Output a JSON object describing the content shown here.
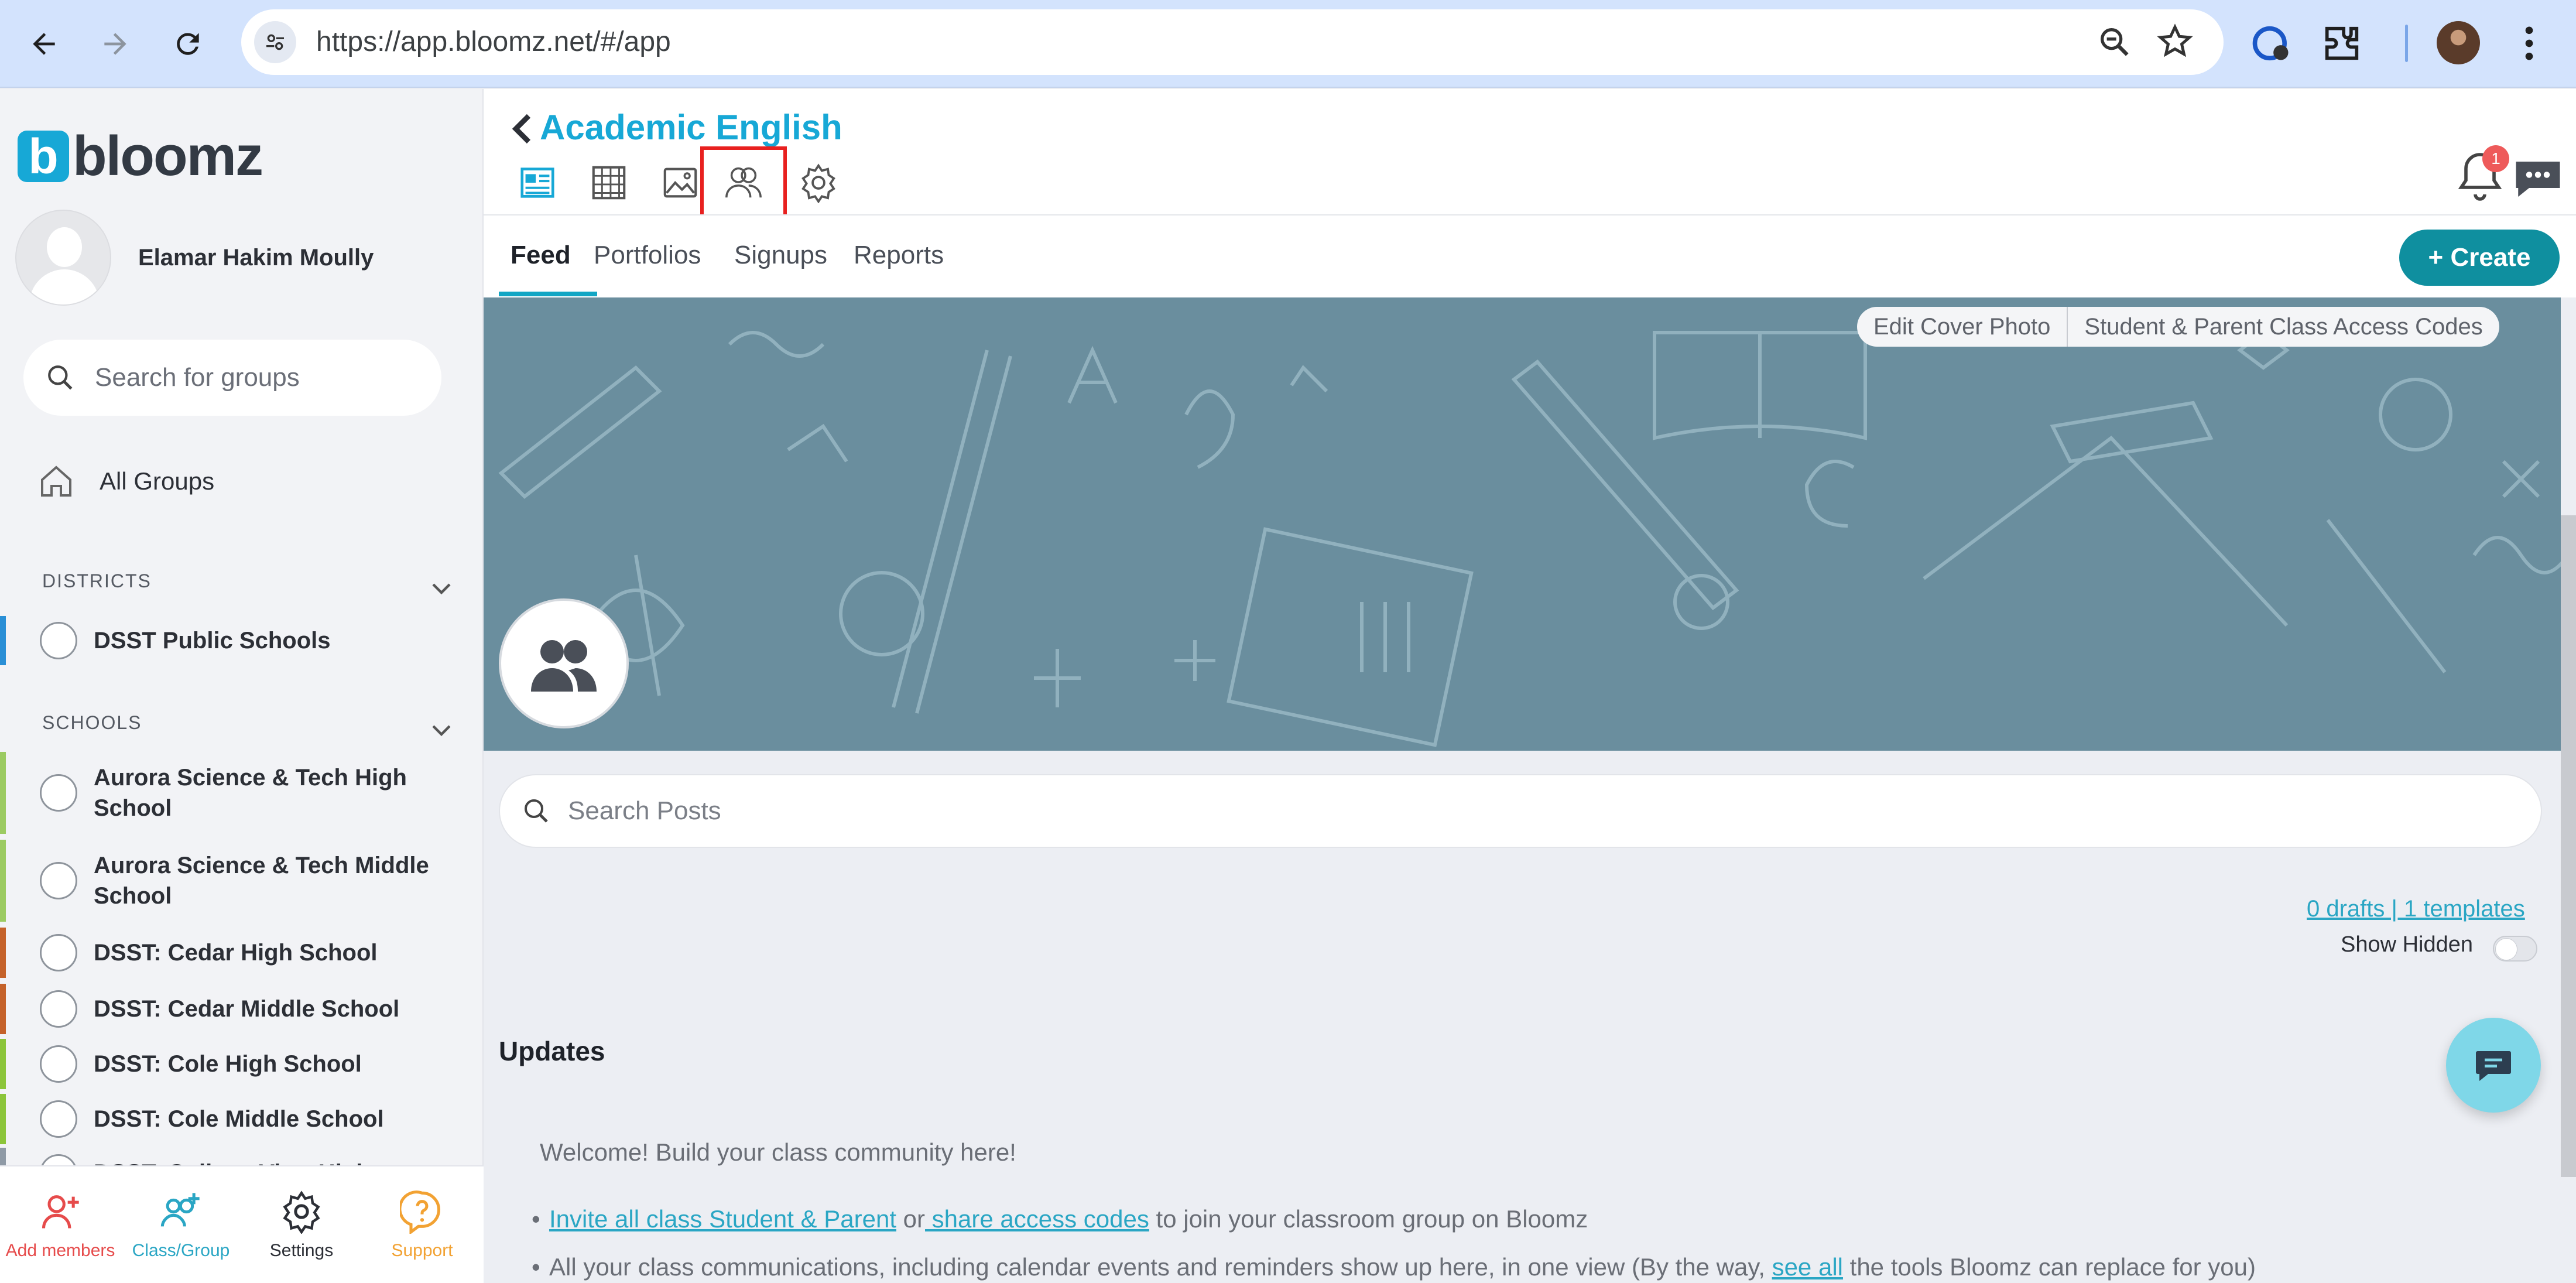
{
  "browser": {
    "url": "https://app.bloomz.net/#/app"
  },
  "sidebar": {
    "logo_text": "bloomz",
    "logo_letter": "b",
    "user_name": "Elamar Hakim Moully",
    "search_placeholder": "Search for groups",
    "all_groups_label": "All Groups",
    "districts_heading": "DISTRICTS",
    "districts": [
      {
        "label": "DSST Public Schools",
        "color": "#2a8fd6"
      }
    ],
    "schools_heading": "SCHOOLS",
    "schools": [
      {
        "label": "Aurora Science & Tech High School",
        "color": "#9ccb62"
      },
      {
        "label": "Aurora Science & Tech Middle School",
        "color": "#9ccb62"
      },
      {
        "label": "DSST: Cedar High School",
        "color": "#c5622a"
      },
      {
        "label": "DSST: Cedar Middle School",
        "color": "#c5622a"
      },
      {
        "label": "DSST: Cole High School",
        "color": "#8cc53a"
      },
      {
        "label": "DSST: Cole Middle School",
        "color": "#8cc53a"
      },
      {
        "label": "DSST: College View High",
        "color": "#8f9aa6"
      }
    ],
    "bottom_nav": [
      {
        "label": "Add members",
        "color": "#e64b4b"
      },
      {
        "label": "Class/Group",
        "color": "#2aa6c4"
      },
      {
        "label": "Settings",
        "color": "#2c2f36"
      },
      {
        "label": "Support",
        "color": "#f2a233"
      }
    ]
  },
  "header": {
    "class_title": "Academic English",
    "notification_count": "1",
    "tabs": [
      "Feed",
      "Portfolios",
      "Signups",
      "Reports"
    ],
    "create_label": "+ Create"
  },
  "cover": {
    "edit_cover_label": "Edit Cover Photo",
    "access_codes_label": "Student & Parent Class Access Codes"
  },
  "feed": {
    "search_placeholder": "Search Posts",
    "drafts_link": "0 drafts | 1 templates",
    "show_hidden_label": "Show Hidden",
    "updates_heading": "Updates",
    "welcome_text": "Welcome! Build your class community here!",
    "bullet1": {
      "link1": "Invite all class Student & Parent",
      "mid": " or",
      "link2": " share access codes",
      "end": " to join your classroom group on Bloomz"
    },
    "bullet2": {
      "start": "All your class communications, including calendar events and reminders show up here, in one view (By the way, ",
      "link": "see all",
      "end": " the tools Bloomz can replace for you)"
    }
  },
  "colors": {
    "brand": "#17a8d6",
    "create_button": "#0f8f9f",
    "cover_bg": "#6a8e9e",
    "highlight_box": "#e8201f"
  }
}
